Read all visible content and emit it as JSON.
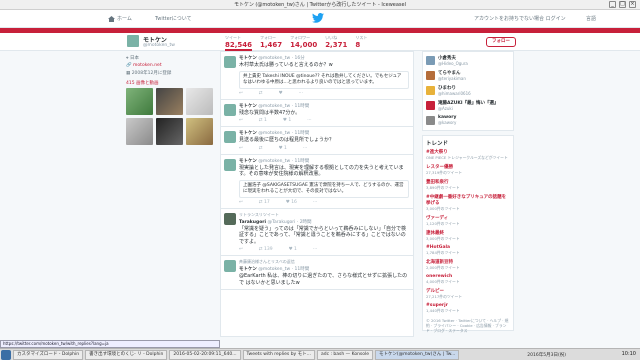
{
  "window": {
    "title": "モトケン (@motoken_tw)さん | Twitterから改行したツイート - Iceweasel"
  },
  "nav": {
    "home": "ホーム",
    "about": "Twitterについて",
    "signup": "アカウントをお持ちでない場合 ログイン",
    "login": "言語"
  },
  "profile": {
    "name": "モトケン",
    "handle": "@motoken_tw",
    "follow": "フォロー",
    "location": "日本",
    "website": "motoken.net",
    "joined": "2008年12月に登録",
    "media_title": "415 画像と動画",
    "stats": [
      {
        "label": "ツイート",
        "value": "82,546"
      },
      {
        "label": "フォロー",
        "value": "1,467"
      },
      {
        "label": "フォロワー",
        "value": "14,000"
      },
      {
        "label": "いいね",
        "value": "2,371"
      },
      {
        "label": "リスト",
        "value": "8"
      }
    ]
  },
  "tweets": [
    {
      "ctx": "",
      "name": "モトケン",
      "handle": "@motoken_tw · 16分",
      "text": "木村草太氏は勝っていると言えるのか？w",
      "quote": "井上貴史 Takeshi INOUE @tinoue?? それは勘弁してください。でもセジュアなはいわゆる中原は...と思われるより良いのではと思っています。",
      "rt": "",
      "likes": ""
    },
    {
      "ctx": "",
      "name": "モトケン",
      "handle": "@motoken_tw · 11時間",
      "text": "残念な質問は半数47分か。",
      "quote": "",
      "rt": "1",
      "likes": "1"
    },
    {
      "ctx": "",
      "name": "モトケン",
      "handle": "@motoken_tw · 11時間",
      "text": "見送る最後に歴ちのは程見所でしょうか？",
      "quote": "",
      "rt": "",
      "likes": "1"
    },
    {
      "ctx": "",
      "name": "モトケン",
      "handle": "@motoken_tw · 11時間",
      "text": "現実論とした発言は、現実を理解する根拠としての力を失うと考えています。その意味が安住院様の解釈改憲。",
      "quote": "上園浩子 @SAKIGASETSUGAE 憲法で衆院を持ち一人で、どうするのか、運営に現実をわれることが大切で、その反対ではない。",
      "rt": "17",
      "likes": "16"
    },
    {
      "ctx": "リトランスリツイート",
      "name": "Tarakugori",
      "handle": "@Tarakugori · 2時間",
      "text": "「常識を疑う」ってのは「常識でからといって鵜呑みにしない」「自分で検証する」ことであって、「常識と違うことを鵜呑みにする」ことではないのですよ。",
      "quote": "",
      "rt": "139",
      "likes": "1"
    },
    {
      "ctx": "斉藤康治様さんとリスベの返信",
      "name": "モトケン",
      "handle": "@motoken_tw · 11時間",
      "text": "@EarKarth 私は、棒の切りに過ぎたので、さらな様式とせずに拡張したので はないかと思いましたw",
      "quote": "",
      "rt": "",
      "likes": ""
    }
  ],
  "suggest": [
    {
      "name": "小倉秀夫",
      "handle": "@Hideo_Ogura",
      "color": "#7a9bb5"
    },
    {
      "name": "てらやまん",
      "handle": "@teriyakiman",
      "color": "#b56d3a"
    },
    {
      "name": "ひまわり",
      "handle": "@himawari0616",
      "color": "#e8b23a"
    },
    {
      "name": "滝藤AZUKI『最』悔い『選』",
      "handle": "@Azuki",
      "color": "#c7203a"
    },
    {
      "name": "kawory",
      "handle": "@kawory",
      "color": "#8a8a8a"
    }
  ],
  "trends": {
    "title": "トレンド",
    "items": [
      {
        "name": "#進大祭り",
        "sub": "ONE PIECE トレジャークルーズなどがツイート"
      },
      {
        "name": "レスター優勝",
        "sub": "27,319件のツイート"
      },
      {
        "name": "豊田和泉行",
        "sub": "3,890件のツイート"
      },
      {
        "name": "#中継劇一番好きなプリキュアの話題を挙げる",
        "sub": "3,000件のツイート"
      },
      {
        "name": "ヴァーディ",
        "sub": "1,120件のツイート"
      },
      {
        "name": "連休最終",
        "sub": "3,000件のツイート"
      },
      {
        "name": "#HotGala",
        "sub": "1,784件のツイート"
      },
      {
        "name": "北海道新豆特",
        "sub": "2,000件のツイート"
      },
      {
        "name": "onerewich",
        "sub": "4,000件のツイート"
      },
      {
        "name": "デルピー",
        "sub": "27,217件のツイート"
      },
      {
        "name": "#superjr",
        "sub": "1,440件のツイート"
      }
    ],
    "footer": "© 2016 Twitter · Twitterについて · ヘルプ · 規約 · プライバシー · Cookie · 広告情報 · ブランド · ブログ · ステータス"
  },
  "status_url": "https://twitter.com/motoken_tw/with_replies?lang=ja",
  "taskbar": {
    "items": [
      "カスタマイズロード - Dolphin",
      "書き出す環境とのくじ- リ - Dolphin",
      "2016-05-02-20:09:11_640...",
      "Tweets with replies by モト...",
      "adc : bash — Konsole",
      "モトケン(@motoken_tw)さん | Tw..."
    ],
    "user": "2016年5月3日(祝)",
    "date": "祝",
    "clock": "10:10"
  }
}
